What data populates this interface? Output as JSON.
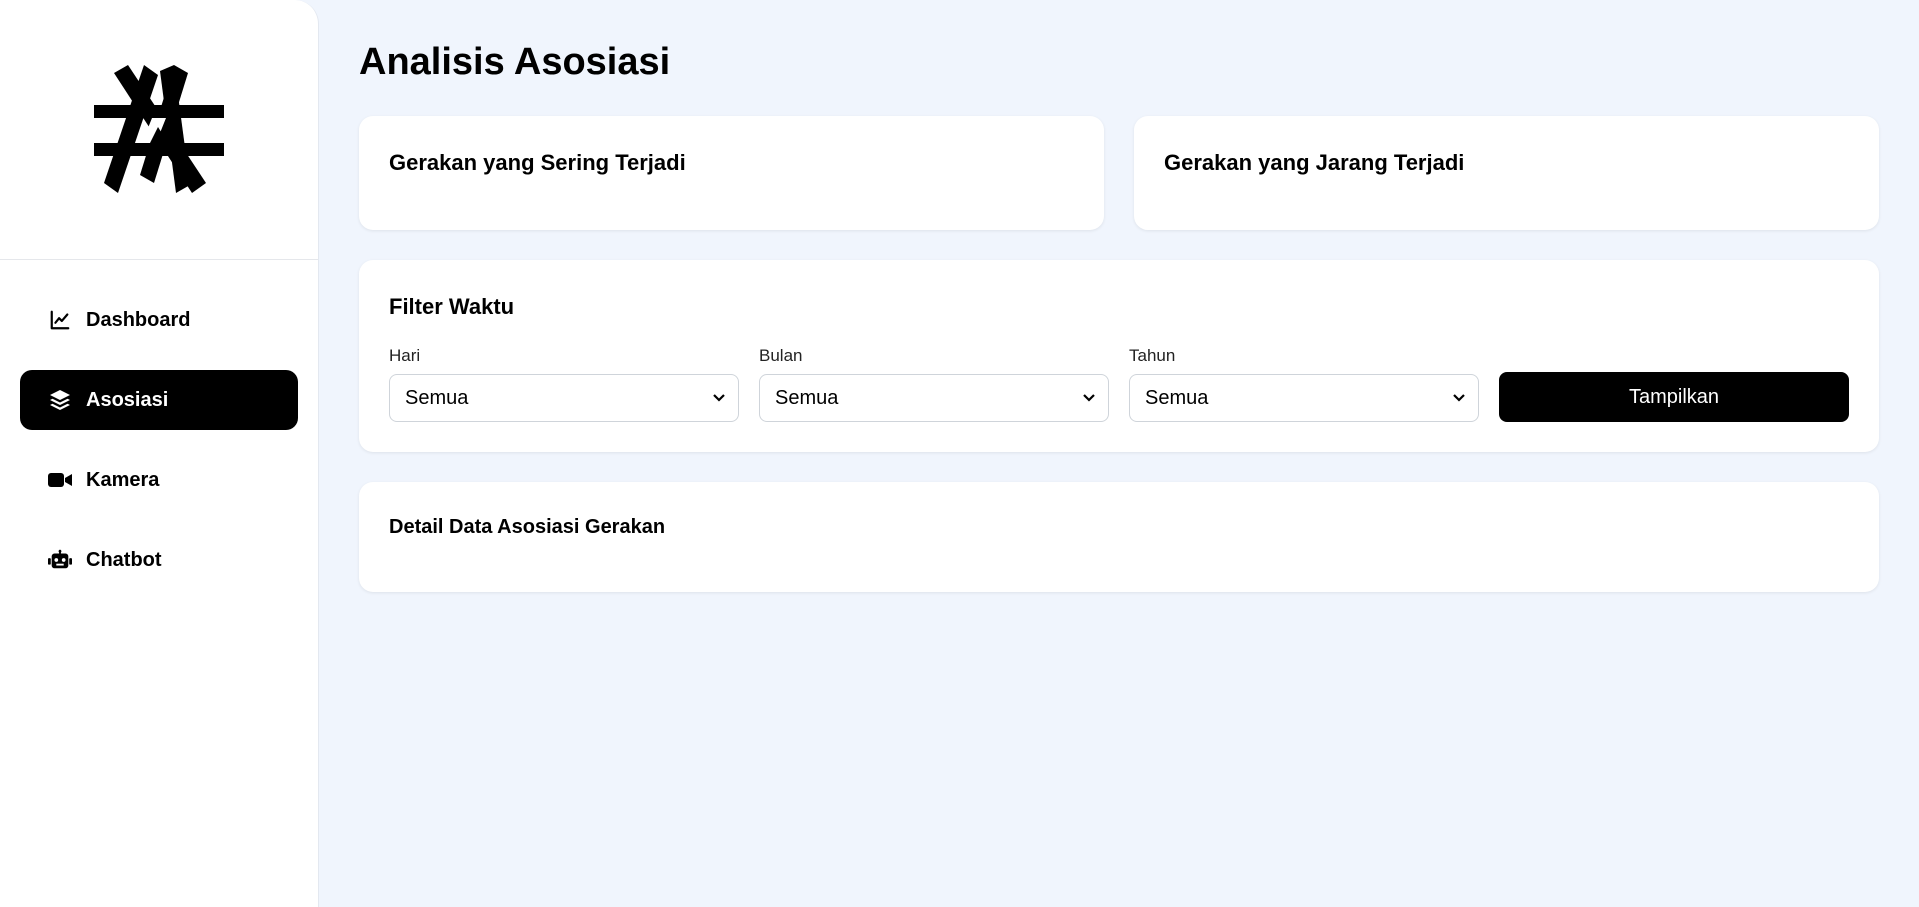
{
  "sidebar": {
    "logo_icon": "brand-logo-icon",
    "items": [
      {
        "label": "Dashboard",
        "icon": "chart-line-icon",
        "active": false
      },
      {
        "label": "Asosiasi",
        "icon": "layers-icon",
        "active": true
      },
      {
        "label": "Kamera",
        "icon": "video-camera-icon",
        "active": false
      },
      {
        "label": "Chatbot",
        "icon": "robot-icon",
        "active": false
      }
    ]
  },
  "main": {
    "title": "Analisis Asosiasi",
    "cards": {
      "frequent": "Gerakan yang Sering Terjadi",
      "rare": "Gerakan yang Jarang Terjadi"
    },
    "filter": {
      "title": "Filter Waktu",
      "day": {
        "label": "Hari",
        "value": "Semua"
      },
      "month": {
        "label": "Bulan",
        "value": "Semua"
      },
      "year": {
        "label": "Tahun",
        "value": "Semua"
      },
      "button": "Tampilkan"
    },
    "detail": {
      "title": "Detail Data Asosiasi Gerakan"
    }
  },
  "colors": {
    "background": "#f0f5fd",
    "accent": "#000000",
    "surface": "#ffffff"
  }
}
